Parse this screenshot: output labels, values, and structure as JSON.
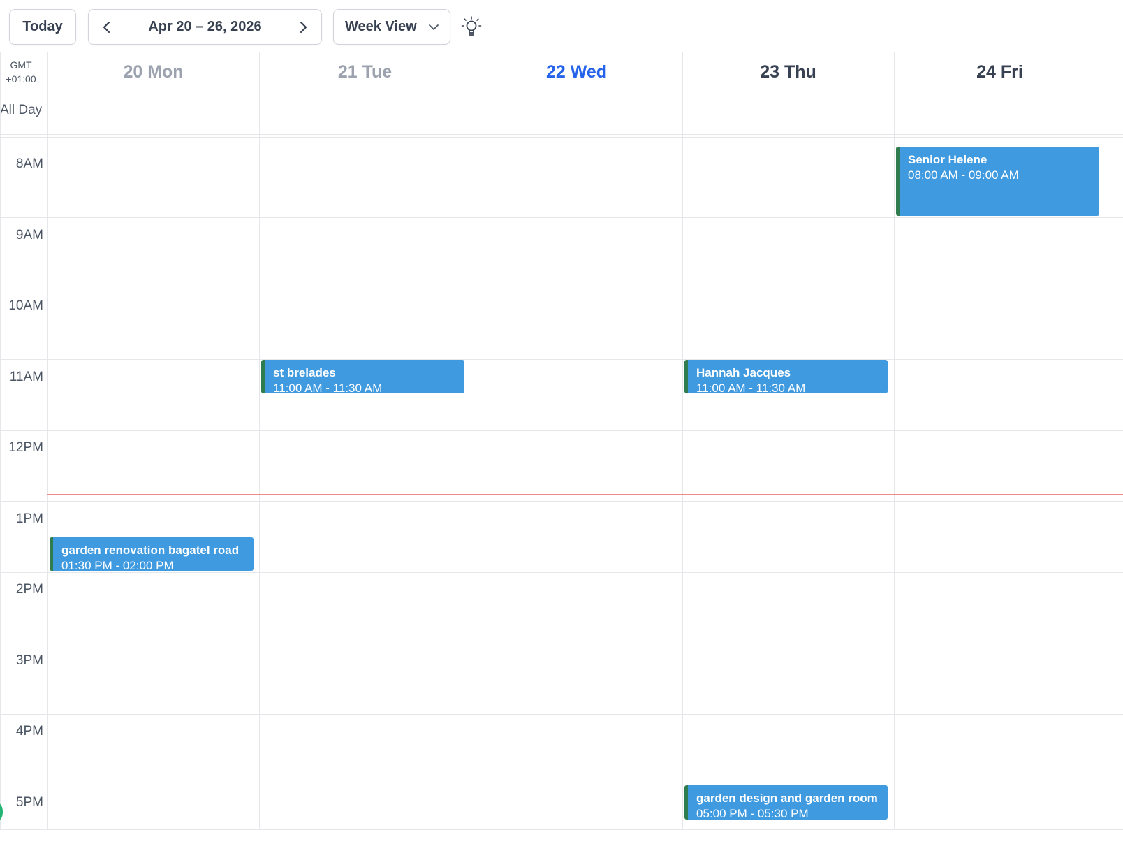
{
  "toolbar": {
    "today_label": "Today",
    "range_label": "Apr 20 – 26, 2026",
    "view_label": "Week View"
  },
  "grid": {
    "timezone_line1": "GMT",
    "timezone_line2": "+01:00",
    "all_day_label": "All Day",
    "days": [
      {
        "label": "20 Mon",
        "state": "past"
      },
      {
        "label": "21 Tue",
        "state": "past"
      },
      {
        "label": "22 Wed",
        "state": "today"
      },
      {
        "label": "23 Thu",
        "state": "future"
      },
      {
        "label": "24 Fri",
        "state": "future"
      }
    ],
    "hours": [
      "8AM",
      "9AM",
      "10AM",
      "11AM",
      "12PM",
      "1PM",
      "2PM",
      "3PM",
      "4PM",
      "5PM"
    ]
  },
  "events": [
    {
      "title": "Senior Helene",
      "time": "08:00 AM - 09:00 AM"
    },
    {
      "title": "st brelades",
      "time": "11:00 AM - 11:30 AM"
    },
    {
      "title": "Hannah Jacques",
      "time": "11:00 AM - 11:30 AM"
    },
    {
      "title": "garden renovation bagatel road",
      "time": "01:30 PM - 02:00 PM"
    },
    {
      "title": "garden design and garden room",
      "time": "05:00 PM - 05:30 PM"
    }
  ],
  "colors": {
    "event_bg": "#3f9ae0",
    "event_accent": "#2f7d4f",
    "today_header": "#2563eb",
    "now_line": "#f08a8a"
  }
}
